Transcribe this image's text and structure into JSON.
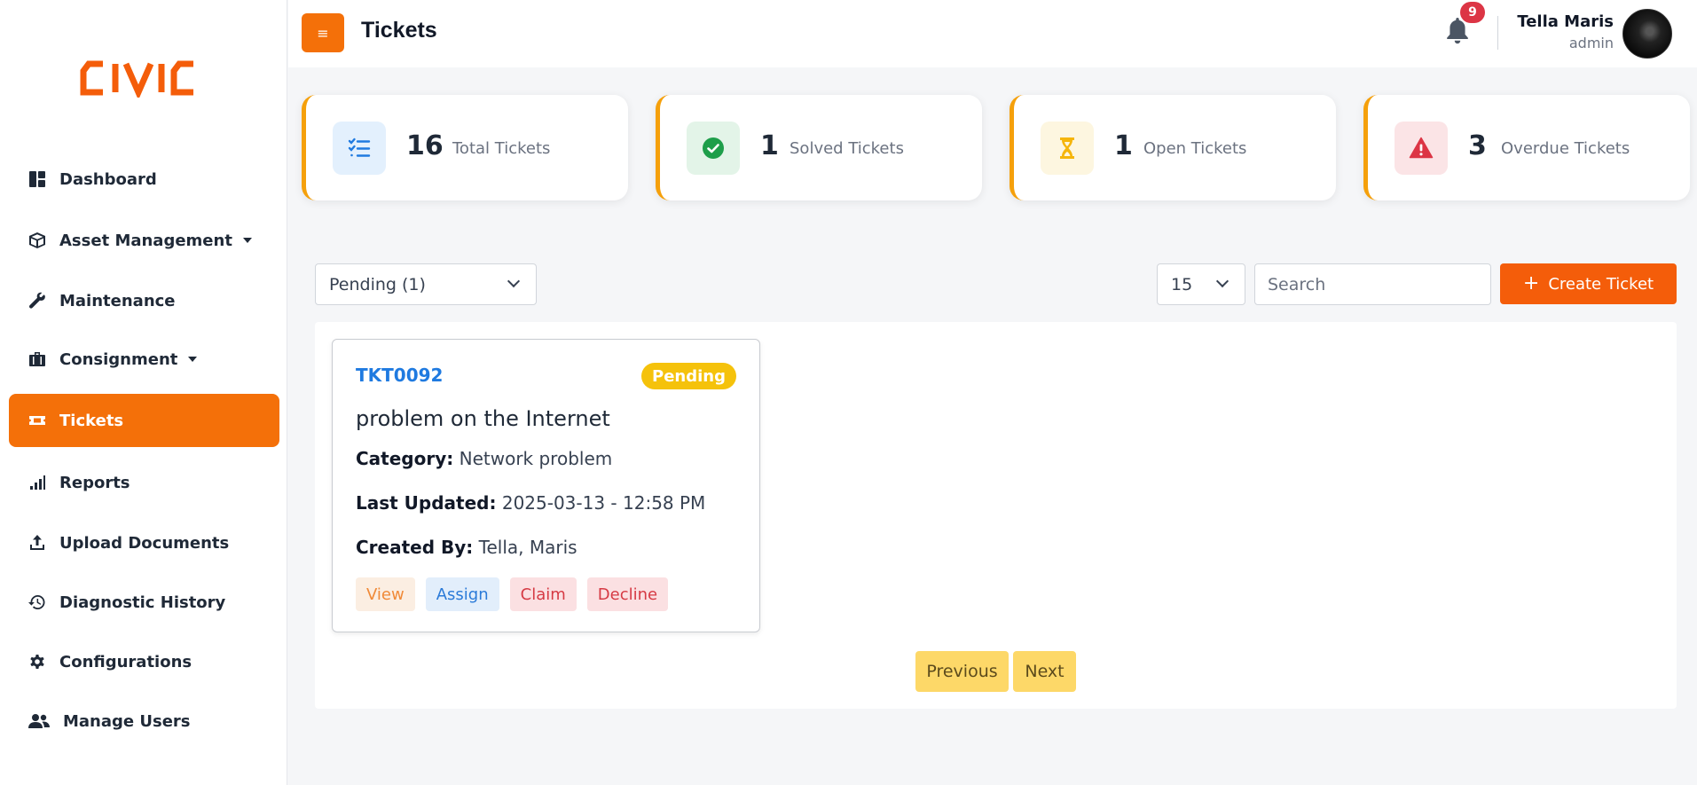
{
  "app": {
    "logo_text": "CIVIC",
    "brand_color": "#f47009"
  },
  "header": {
    "title": "Tickets",
    "notification_count": "9",
    "user_name": "Tella Maris",
    "user_role": "admin"
  },
  "sidebar": {
    "items": [
      {
        "label": "Dashboard",
        "icon": "dashboard-icon"
      },
      {
        "label": "Asset Management",
        "icon": "cube-icon",
        "has_dropdown": true
      },
      {
        "label": "Maintenance",
        "icon": "wrench-icon"
      },
      {
        "label": "Consignment",
        "icon": "briefcase-icon",
        "has_dropdown": true
      },
      {
        "label": "Tickets",
        "icon": "ticket-icon",
        "active": true
      },
      {
        "label": "Reports",
        "icon": "signal-bars-icon"
      },
      {
        "label": "Upload Documents",
        "icon": "upload-icon"
      },
      {
        "label": "Diagnostic History",
        "icon": "history-icon"
      },
      {
        "label": "Configurations",
        "icon": "gear-icon"
      },
      {
        "label": "Manage Users",
        "icon": "users-icon"
      }
    ]
  },
  "stats": [
    {
      "value": "16",
      "label": "Total Tickets",
      "icon": "checklist-icon",
      "color": "#1f7ae0",
      "bg": "#e3f0fd"
    },
    {
      "value": "1",
      "label": "Solved Tickets",
      "icon": "check-circle-icon",
      "color": "#1e9e4a",
      "bg": "#e3f4e8"
    },
    {
      "value": "1",
      "label": "Open Tickets",
      "icon": "hourglass-icon",
      "color": "#f5b50b",
      "bg": "#fdf6e0"
    },
    {
      "value": "3",
      "label": "Overdue Tickets",
      "icon": "warning-icon",
      "color": "#dc3545",
      "bg": "#fbe4e6"
    }
  ],
  "controls": {
    "status_filter": "Pending (1)",
    "per_page": "15",
    "search_placeholder": "Search",
    "create_button": "Create Ticket"
  },
  "tickets": [
    {
      "id": "TKT0092",
      "status": "Pending",
      "title": "problem on the Internet",
      "category_label": "Category:",
      "category": "Network problem",
      "updated_label": "Last Updated:",
      "updated": "2025-03-13 - 12:58 PM",
      "created_label": "Created By:",
      "created_by": "Tella, Maris",
      "actions": [
        "View",
        "Assign",
        "Claim",
        "Decline"
      ]
    }
  ],
  "pagination": {
    "previous": "Previous",
    "next": "Next"
  }
}
